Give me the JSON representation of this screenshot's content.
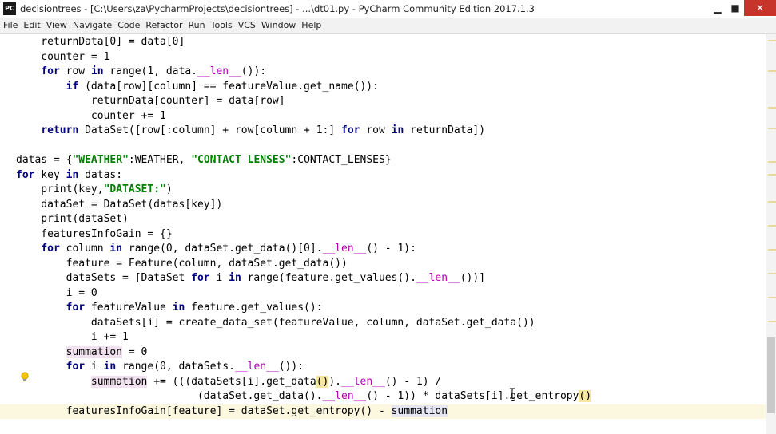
{
  "window": {
    "title": "decisiontrees - [C:\\Users\\za\\PycharmProjects\\decisiontrees] - ...\\dt01.py - PyCharm Community Edition 2017.1.3",
    "app_icon_text": "PC",
    "controls": {
      "minimize": "▁",
      "maximize": "■",
      "close": "✕"
    }
  },
  "menu": [
    "File",
    "Edit",
    "View",
    "Navigate",
    "Code",
    "Refactor",
    "Run",
    "Tools",
    "VCS",
    "Window",
    "Help"
  ],
  "code_lines": [
    [
      {
        "t": "    returnData[0] = data[0]",
        "c": ""
      }
    ],
    [
      {
        "t": "    counter = 1",
        "c": ""
      }
    ],
    [
      {
        "t": "    ",
        "c": ""
      },
      {
        "t": "for",
        "c": "kw"
      },
      {
        "t": " row ",
        "c": ""
      },
      {
        "t": "in",
        "c": "kw"
      },
      {
        "t": " range(1, data.",
        "c": ""
      },
      {
        "t": "__len__",
        "c": "dunder"
      },
      {
        "t": "()):",
        "c": ""
      }
    ],
    [
      {
        "t": "        ",
        "c": ""
      },
      {
        "t": "if",
        "c": "kw"
      },
      {
        "t": " (data[row][column] == featureValue.get_name()):",
        "c": ""
      }
    ],
    [
      {
        "t": "            returnData[counter] = data[row]",
        "c": ""
      }
    ],
    [
      {
        "t": "            counter += 1",
        "c": ""
      }
    ],
    [
      {
        "t": "    ",
        "c": ""
      },
      {
        "t": "return",
        "c": "kw"
      },
      {
        "t": " DataSet([row[:column] + row[column + 1:] ",
        "c": ""
      },
      {
        "t": "for",
        "c": "kw"
      },
      {
        "t": " row ",
        "c": ""
      },
      {
        "t": "in",
        "c": "kw"
      },
      {
        "t": " returnData])",
        "c": ""
      }
    ],
    [
      {
        "t": "",
        "c": ""
      }
    ],
    [
      {
        "t": "datas = {",
        "c": ""
      },
      {
        "t": "\"WEATHER\"",
        "c": "str"
      },
      {
        "t": ":WEATHER, ",
        "c": ""
      },
      {
        "t": "\"CONTACT LENSES\"",
        "c": "str"
      },
      {
        "t": ":CONTACT_LENSES}",
        "c": ""
      }
    ],
    [
      {
        "t": "for",
        "c": "kw"
      },
      {
        "t": " key ",
        "c": ""
      },
      {
        "t": "in",
        "c": "kw"
      },
      {
        "t": " datas:",
        "c": ""
      }
    ],
    [
      {
        "t": "    print(key,",
        "c": ""
      },
      {
        "t": "\"DATASET:\"",
        "c": "str"
      },
      {
        "t": ")",
        "c": ""
      }
    ],
    [
      {
        "t": "    dataSet = DataSet(datas[key])",
        "c": ""
      }
    ],
    [
      {
        "t": "    print(dataSet)",
        "c": ""
      }
    ],
    [
      {
        "t": "    featuresInfoGain = {}",
        "c": ""
      }
    ],
    [
      {
        "t": "    ",
        "c": ""
      },
      {
        "t": "for",
        "c": "kw"
      },
      {
        "t": " column ",
        "c": ""
      },
      {
        "t": "in",
        "c": "kw"
      },
      {
        "t": " range(0, dataSet.get_data()[0].",
        "c": ""
      },
      {
        "t": "__len__",
        "c": "dunder"
      },
      {
        "t": "() - 1):",
        "c": ""
      }
    ],
    [
      {
        "t": "        feature = Feature(column, dataSet.get_data())",
        "c": ""
      }
    ],
    [
      {
        "t": "        dataSets = [DataSet ",
        "c": ""
      },
      {
        "t": "for",
        "c": "kw"
      },
      {
        "t": " i ",
        "c": ""
      },
      {
        "t": "in",
        "c": "kw"
      },
      {
        "t": " range(feature.get_values().",
        "c": ""
      },
      {
        "t": "__len__",
        "c": "dunder"
      },
      {
        "t": "())]",
        "c": ""
      }
    ],
    [
      {
        "t": "        i = 0",
        "c": ""
      }
    ],
    [
      {
        "t": "        ",
        "c": ""
      },
      {
        "t": "for",
        "c": "kw"
      },
      {
        "t": " featureValue ",
        "c": ""
      },
      {
        "t": "in",
        "c": "kw"
      },
      {
        "t": " feature.get_values():",
        "c": ""
      }
    ],
    [
      {
        "t": "            dataSets[i] = create_data_set(featureValue, column, dataSet.get_data())",
        "c": ""
      }
    ],
    [
      {
        "t": "            i += 1",
        "c": ""
      }
    ],
    [
      {
        "t": "        ",
        "c": ""
      },
      {
        "t": "summation",
        "c": "hl-var"
      },
      {
        "t": " = 0",
        "c": ""
      }
    ],
    [
      {
        "t": "        ",
        "c": ""
      },
      {
        "t": "for",
        "c": "kw"
      },
      {
        "t": " i ",
        "c": ""
      },
      {
        "t": "in",
        "c": "kw"
      },
      {
        "t": " range(0, dataSets.",
        "c": ""
      },
      {
        "t": "__len__",
        "c": "dunder"
      },
      {
        "t": "()):",
        "c": ""
      }
    ],
    [
      {
        "t": "            ",
        "c": ""
      },
      {
        "t": "summation",
        "c": "hl-var"
      },
      {
        "t": " += (((dataSets[i].get_data",
        "c": ""
      },
      {
        "t": "()",
        "c": "brace"
      },
      {
        "t": ").",
        "c": ""
      },
      {
        "t": "__len__",
        "c": "dunder"
      },
      {
        "t": "() - 1) /",
        "c": ""
      }
    ],
    [
      {
        "t": "                             (dataSet.get_data().",
        "c": ""
      },
      {
        "t": "__len__",
        "c": "dunder"
      },
      {
        "t": "() - 1)) * dataSets[i].get_entropy",
        "c": ""
      },
      {
        "t": "()",
        "c": "brace"
      }
    ],
    [
      {
        "t": "        featuresInfoGain[feature] = dataSet.get_entropy() - ",
        "c": ""
      },
      {
        "t": "summation",
        "c": "hl-read"
      }
    ]
  ],
  "current_line_index": 25,
  "colors": {
    "keyword": "#000080",
    "string": "#008000",
    "dunder": "#b200b2",
    "current_line": "#fcf8e0",
    "close_button": "#c7342a"
  },
  "icons": {
    "app": "pycharm-logo-icon",
    "gutter_hint": "lightbulb-icon",
    "pointer": "text-cursor-icon"
  }
}
